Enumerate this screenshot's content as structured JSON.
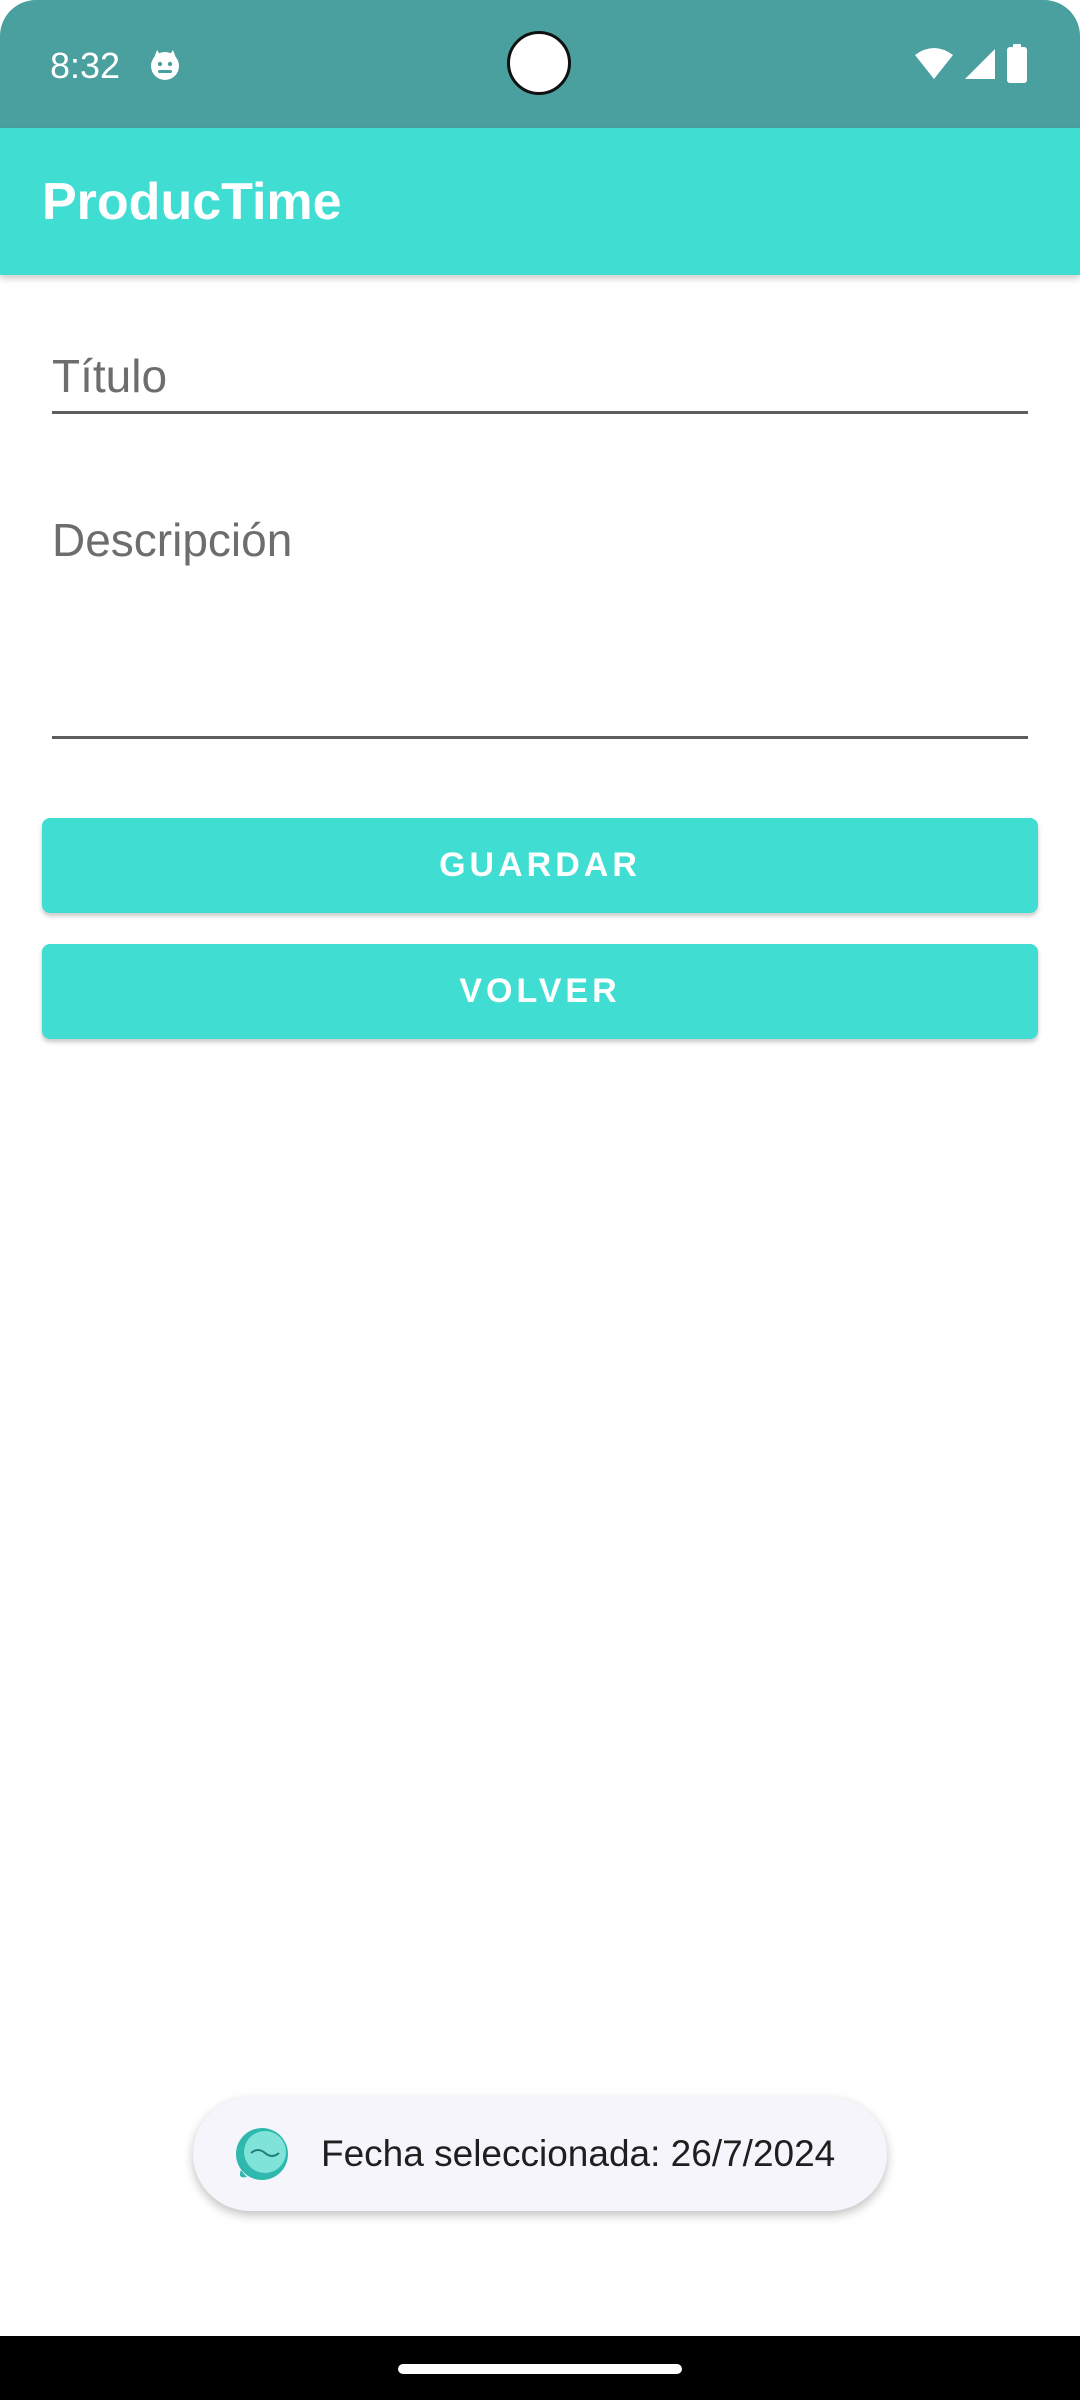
{
  "status_bar": {
    "time": "8:32",
    "notification_icon": "android-cat-icon",
    "wifi_icon": "wifi-icon",
    "signal_icon": "cell-signal-icon",
    "battery_icon": "battery-icon"
  },
  "app_bar": {
    "title": "ProducTime"
  },
  "form": {
    "title_placeholder": "Título",
    "title_value": "",
    "description_placeholder": "Descripción",
    "description_value": ""
  },
  "buttons": {
    "save_label": "GUARDAR",
    "back_label": "VOLVER"
  },
  "toast": {
    "icon": "app-logo-icon",
    "message": "Fecha seleccionada: 26/7/2024"
  },
  "colors": {
    "status_bar": "#4a9f9f",
    "accent": "#40ddd2",
    "toast_bg": "#f5f5fb"
  }
}
